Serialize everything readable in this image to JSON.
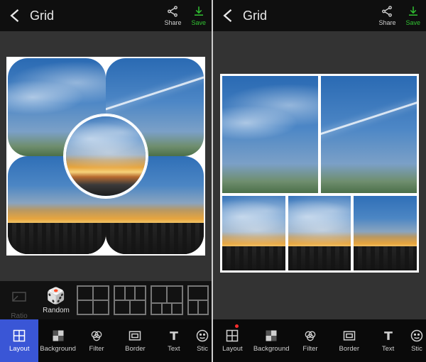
{
  "panes": [
    {
      "header": {
        "title": "Grid",
        "share": "Share",
        "save": "Save"
      },
      "secondary": {
        "ratio": "Ratio",
        "random": "Random"
      },
      "bottom": {
        "layout": "Layout",
        "background": "Background",
        "filter": "Filter",
        "border": "Border",
        "text": "Text",
        "sticker": "Stic",
        "selected": "layout",
        "reddot": false
      }
    },
    {
      "header": {
        "title": "Grid",
        "share": "Share",
        "save": "Save"
      },
      "bottom": {
        "layout": "Layout",
        "background": "Background",
        "filter": "Filter",
        "border": "Border",
        "text": "Text",
        "sticker": "Stic",
        "selected": "",
        "reddot": true
      }
    }
  ],
  "colors": {
    "accent": "#31c232",
    "selected": "#3a56d6"
  }
}
